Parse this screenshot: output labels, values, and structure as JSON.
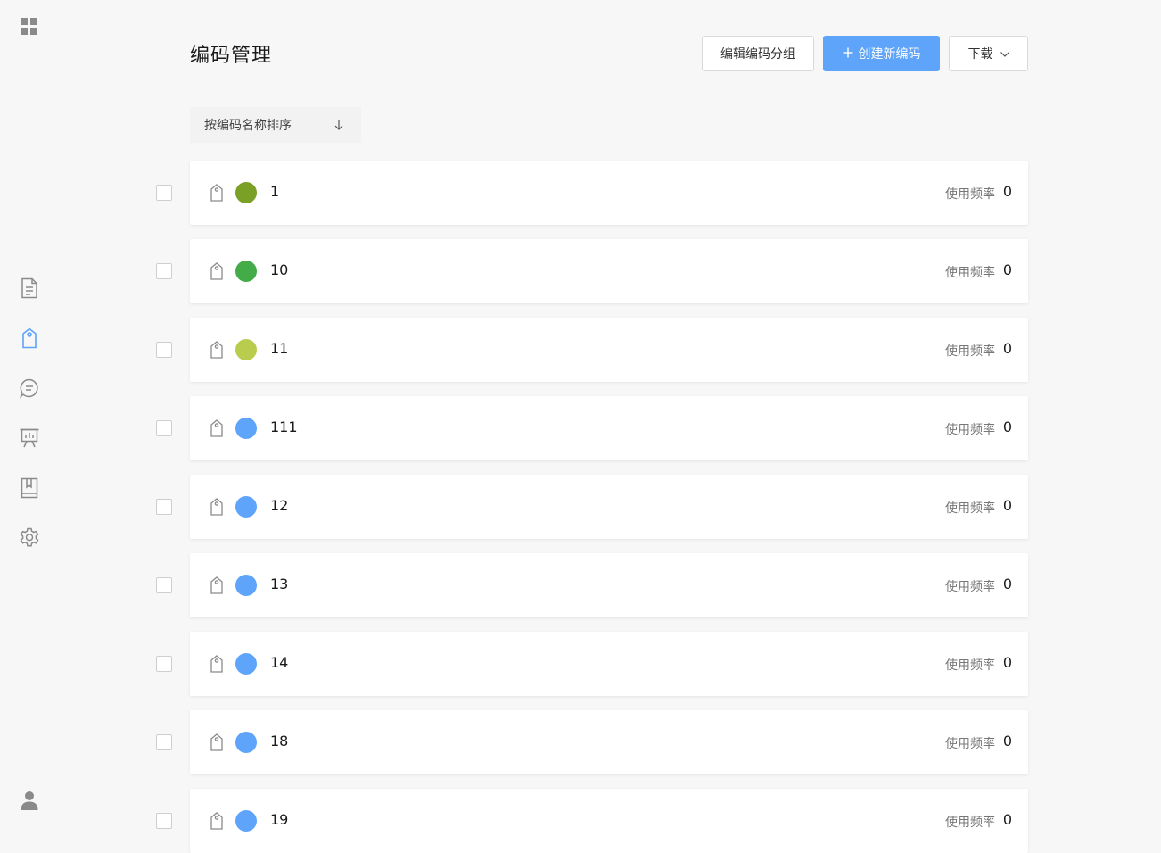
{
  "sidebar": {
    "top_icon": "grid-icon",
    "items": [
      {
        "icon": "document-icon",
        "active": false
      },
      {
        "icon": "tag-icon",
        "active": true
      },
      {
        "icon": "chat-icon",
        "active": false
      },
      {
        "icon": "presentation-chart-icon",
        "active": false
      },
      {
        "icon": "book-icon",
        "active": false
      },
      {
        "icon": "gear-icon",
        "active": false
      }
    ],
    "bottom_icon": "user-icon"
  },
  "header": {
    "title": "编码管理",
    "edit_group_label": "编辑编码分组",
    "create_label": "创建新编码",
    "download_label": "下载"
  },
  "sort": {
    "label": "按编码名称排序"
  },
  "codes": [
    {
      "name": "1",
      "color": "#7aa025",
      "freq_label": "使用频率",
      "freq": "0"
    },
    {
      "name": "10",
      "color": "#43ac48",
      "freq_label": "使用频率",
      "freq": "0"
    },
    {
      "name": "11",
      "color": "#b9cc4e",
      "freq_label": "使用频率",
      "freq": "0"
    },
    {
      "name": "111",
      "color": "#5ea4fa",
      "freq_label": "使用频率",
      "freq": "0"
    },
    {
      "name": "12",
      "color": "#5ea4fa",
      "freq_label": "使用频率",
      "freq": "0"
    },
    {
      "name": "13",
      "color": "#5ea4fa",
      "freq_label": "使用频率",
      "freq": "0"
    },
    {
      "name": "14",
      "color": "#5ea4fa",
      "freq_label": "使用频率",
      "freq": "0"
    },
    {
      "name": "18",
      "color": "#5ea4fa",
      "freq_label": "使用频率",
      "freq": "0"
    },
    {
      "name": "19",
      "color": "#5ea4fa",
      "freq_label": "使用频率",
      "freq": "0"
    }
  ],
  "colors": {
    "accent": "#5ea4fa",
    "icon_gray": "#8a8a8a"
  }
}
